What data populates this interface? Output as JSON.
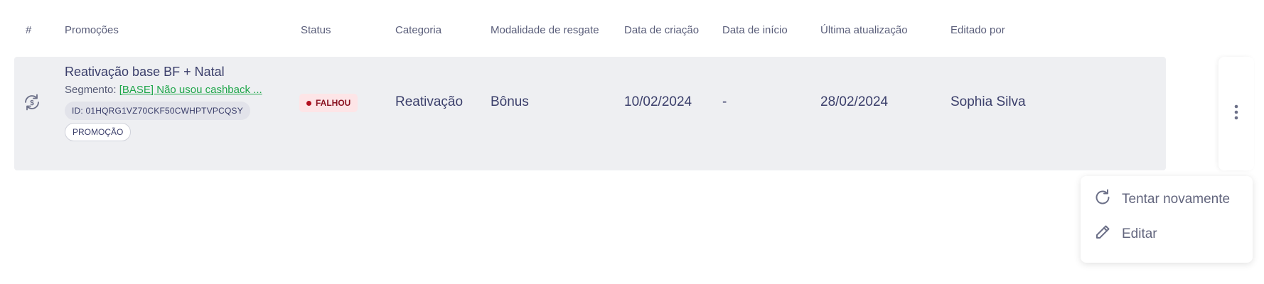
{
  "table": {
    "headers": {
      "index": "#",
      "promotions": "Promoções",
      "status": "Status",
      "category": "Categoria",
      "redemption": "Modalidade de resgate",
      "created": "Data de criação",
      "start": "Data de início",
      "updated": "Última atualização",
      "edited_by": "Editado por"
    },
    "rows": [
      {
        "icon": "cashback-refresh-icon",
        "title": "Reativação base BF + Natal",
        "segment_label": "Segmento:",
        "segment_link": "[BASE] Não usou cashback ...",
        "id_text": "ID: 01HQRG1VZ70CKF50CWHPTVPCQSY",
        "type": "PROMOÇÃO",
        "status": "FALHOU",
        "category": "Reativação",
        "redemption": "Bônus",
        "created": "10/02/2024",
        "start": "-",
        "updated": "28/02/2024",
        "edited_by": "Sophia Silva"
      }
    ]
  },
  "row_menu": {
    "icon": "more-vertical-icon",
    "items": [
      {
        "label": "Tentar novamente",
        "icon": "retry-icon"
      },
      {
        "label": "Editar",
        "icon": "pencil-icon"
      }
    ]
  },
  "colors": {
    "row_bg": "#eeeff2",
    "text": "#3b3f6b",
    "link": "#1fa64a",
    "status_bg": "#fde5e7",
    "status_text": "#8a1220"
  }
}
